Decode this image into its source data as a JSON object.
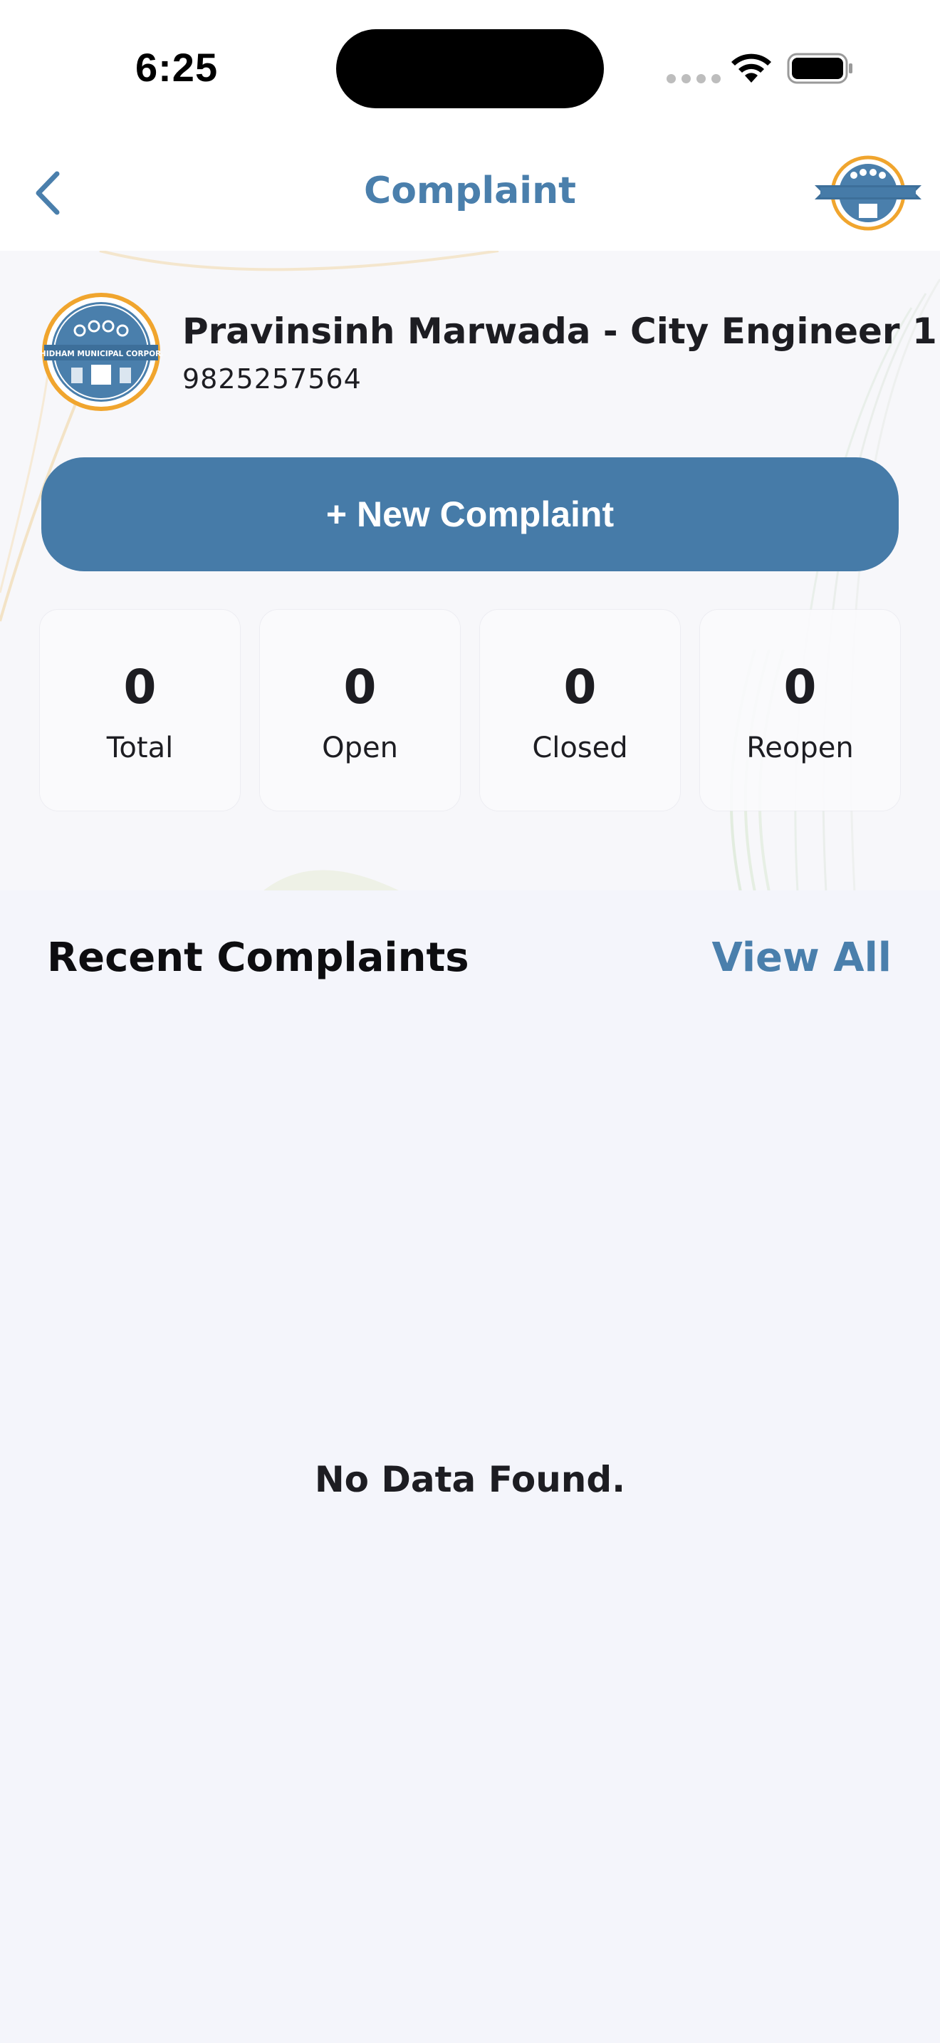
{
  "status_bar": {
    "time": "6:25",
    "icons": [
      "cellular-signal-icon",
      "wifi-icon",
      "battery-icon"
    ]
  },
  "nav": {
    "title": "Complaint",
    "back_icon": "chevron-left-icon",
    "logo": "gandhidham-municipal-corporation-logo"
  },
  "profile": {
    "name": "Pravinsinh Marwada - City Engineer 1",
    "phone": "9825257564",
    "logo_text": "GANDHIDHAM MUNICIPAL CORPORATION"
  },
  "actions": {
    "new_complaint_label": "+ New Complaint"
  },
  "stats": [
    {
      "value": "0",
      "label": "Total"
    },
    {
      "value": "0",
      "label": "Open"
    },
    {
      "value": "0",
      "label": "Closed"
    },
    {
      "value": "0",
      "label": "Reopen"
    }
  ],
  "recent": {
    "title": "Recent Complaints",
    "view_all_label": "View All",
    "empty_message": "No Data Found."
  },
  "colors": {
    "accent": "#467ba8",
    "title_blue": "#4a7fac",
    "background": "#f4f5fb",
    "logo_ring": "#f0a52e"
  }
}
